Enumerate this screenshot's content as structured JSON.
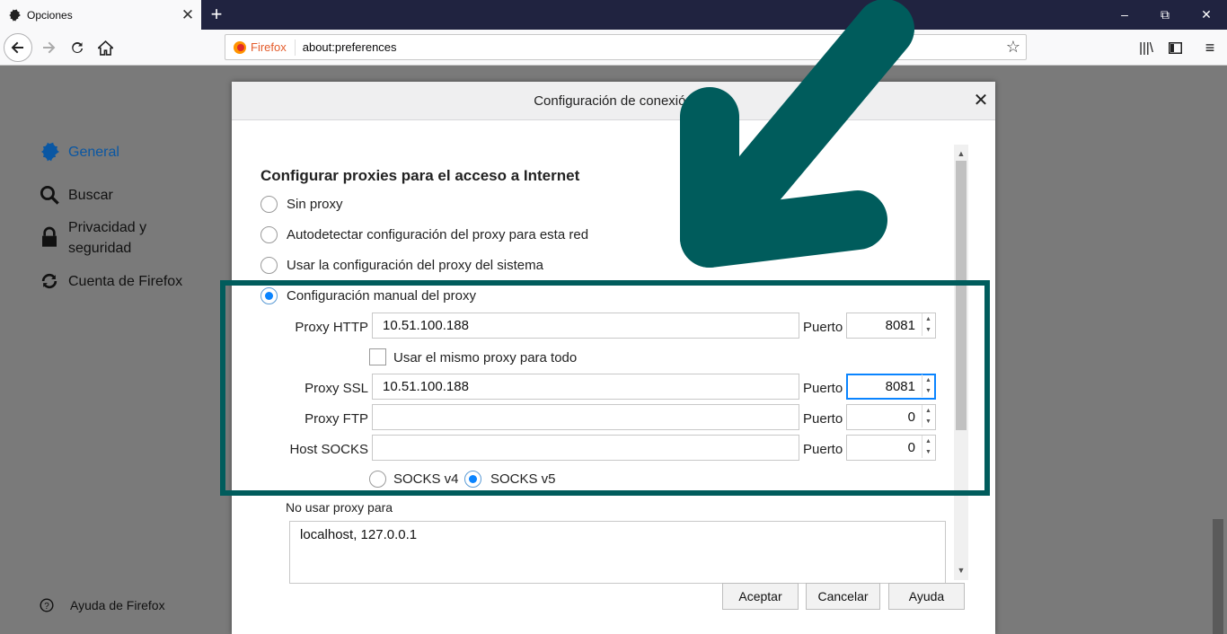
{
  "browser": {
    "tab_title": "Opciones",
    "tab_close": "✕",
    "new_tab": "+",
    "identity": "Firefox",
    "url": "about:preferences"
  },
  "sidebar": {
    "items": [
      {
        "label": "General",
        "icon": "gear-icon"
      },
      {
        "label": "Buscar",
        "icon": "search-icon"
      },
      {
        "label": "Privacidad y seguridad",
        "icon": "lock-icon"
      },
      {
        "label": "Cuenta de Firefox",
        "icon": "sync-icon"
      }
    ],
    "help": "Ayuda de Firefox"
  },
  "dialog": {
    "title": "Configuración de conexión",
    "close": "✕",
    "heading": "Configurar proxies para el acceso a Internet",
    "options": [
      "Sin proxy",
      "Autodetectar configuración del proxy para esta red",
      "Usar la configuración del proxy del sistema",
      "Configuración manual del proxy"
    ],
    "selected_option": "Configuración manual del proxy",
    "http_label": "Proxy HTTP",
    "http_value": "10.51.100.188",
    "http_port": "8081",
    "same_proxy_label": "Usar el mismo proxy para todo",
    "ssl_label": "Proxy SSL",
    "ssl_value": "10.51.100.188",
    "ssl_port": "8081",
    "ftp_label": "Proxy FTP",
    "ftp_value": "",
    "ftp_port": "0",
    "socks_label": "Host SOCKS",
    "socks_value": "",
    "socks_port": "0",
    "port_label": "Puerto",
    "socks_v4": "SOCKS v4",
    "socks_v5": "SOCKS v5",
    "no_proxy_label": "No usar proxy para",
    "no_proxy_value": "localhost, 127.0.0.1",
    "buttons": {
      "accept": "Aceptar",
      "cancel": "Cancelar",
      "help": "Ayuda"
    }
  },
  "colors": {
    "accent": "#0a84ff",
    "annotation": "#005c5c",
    "tabstrip": "#202340"
  }
}
